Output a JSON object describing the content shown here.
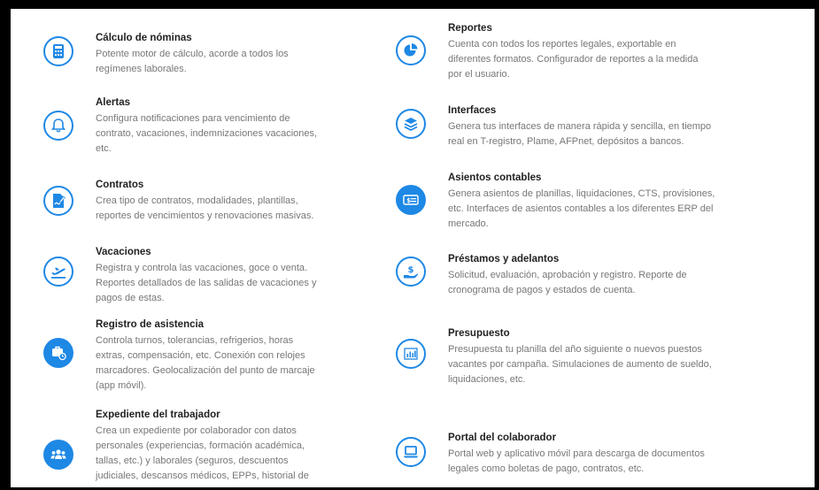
{
  "features": [
    {
      "title": "Cálculo de nóminas",
      "desc": [
        "Potente motor de cálculo, acorde a todos los",
        "regímenes laborales."
      ],
      "icon": "calculator-icon"
    },
    {
      "title": "Alertas",
      "desc": [
        "Configura notificaciones para vencimiento de",
        "contrato, vacaciones, indemnizaciones vacaciones,",
        "etc."
      ],
      "icon": "bell-icon"
    },
    {
      "title": "Contratos",
      "desc": [
        "Crea tipo de contratos, modalidades, plantillas,",
        "reportes de vencimientos y renovaciones masivas."
      ],
      "icon": "contract-sign-icon"
    },
    {
      "title": "Vacaciones",
      "desc": [
        "Registra y controla las vacaciones, goce o venta.",
        "Reportes detallados de las salidas de vacaciones y",
        "pagos de estas."
      ],
      "icon": "airplane-icon"
    },
    {
      "title": "Registro de asistencia",
      "desc": [
        "Controla turnos, tolerancias, refrigerios, horas",
        "extras, compensación, etc. Conexión con relojes",
        "marcadores. Geolocalización del punto de marcaje",
        "(app móvil)."
      ],
      "icon": "briefcase-clock-icon"
    },
    {
      "title": "Expediente del trabajador",
      "desc": [
        "Crea un expediente por colaborador con datos",
        "personales (experiencias, formación académica,",
        "tallas, etc.) y laborales (seguros, descuentos",
        "judiciales, descansos médicos, EPPs, historial de"
      ],
      "icon": "users-group-icon"
    },
    {
      "title": "Reportes",
      "desc": [
        "Cuenta con todos los reportes legales, exportable en",
        "diferentes formatos. Configurador de reportes a la medida",
        "por el usuario."
      ],
      "icon": "pie-chart-icon"
    },
    {
      "title": "Interfaces",
      "desc": [
        "Genera tus interfaces de manera rápida y sencilla, en tiempo",
        "real en T-registro, Plame, AFPnet, depósitos a bancos."
      ],
      "icon": "layers-icon"
    },
    {
      "title": "Asientos contables",
      "desc": [
        "Genera asientos de planillas, liquidaciones, CTS, provisiones,",
        "etc. Interfaces de asientos contables a los diferentes ERP del",
        "mercado."
      ],
      "icon": "money-bill-icon"
    },
    {
      "title": "Préstamos y adelantos",
      "desc": [
        "Solicitud, evaluación, aprobación y registro. Reporte de",
        "cronograma de pagos y estados de cuenta."
      ],
      "icon": "hand-dollar-icon"
    },
    {
      "title": "Presupuesto",
      "desc": [
        "Presupuesta tu planilla del año siguiente o nuevos puestos",
        "vacantes por campaña. Simulaciones de aumento de sueldo,",
        "liquidaciones, etc."
      ],
      "icon": "bar-chart-icon"
    },
    {
      "title": "Portal del colaborador",
      "desc": [
        "Portal web y aplicativo móvil para descarga de documentos",
        "legales como boletas de pago, contratos, etc."
      ],
      "icon": "laptop-icon"
    }
  ],
  "colors": {
    "accent": "#1e88e5",
    "title": "#222222",
    "text": "#777777"
  }
}
